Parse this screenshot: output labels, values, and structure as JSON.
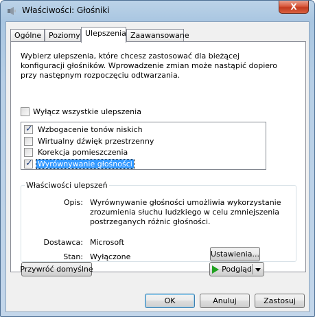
{
  "window": {
    "title": "Właściwości: Głośniki",
    "close_glyph": "X"
  },
  "tabs": [
    {
      "label": "Ogólne"
    },
    {
      "label": "Poziomy"
    },
    {
      "label": "Ulepszenia"
    },
    {
      "label": "Zaawansowane"
    }
  ],
  "enhancements": {
    "intro": "Wybierz ulepszenia, które chcesz zastosować dla bieżącej konfiguracji głośników. Wprowadzenie zmian może nastąpić dopiero przy następnym rozpoczęciu odtwarzania.",
    "disable_all": {
      "label": "Wyłącz wszystkie ulepszenia",
      "checked": false
    },
    "items": [
      {
        "label": "Wzbogacenie tonów niskich",
        "checked": true
      },
      {
        "label": "Wirtualny dźwięk przestrzenny",
        "checked": false
      },
      {
        "label": "Korekcja pomieszczenia",
        "checked": false
      },
      {
        "label": "Wyrównywanie głośności",
        "checked": true,
        "selected": true
      }
    ]
  },
  "properties": {
    "legend": "Właściwości ulepszeń",
    "opis_label": "Opis:",
    "opis_value": "Wyrównywanie głośności umożliwia wykorzystanie zrozumienia słuchu ludzkiego w celu zmniejszenia postrzeganych różnic głośności.",
    "vendor_label": "Dostawca:",
    "vendor_value": "Microsoft",
    "state_label": "Stan:",
    "state_value": "Wyłączone",
    "settings_button": "Ustawienia..."
  },
  "buttons": {
    "restore_defaults": "Przywróć domyślne",
    "preview": "Podgląd",
    "ok": "OK",
    "cancel": "Anuluj",
    "apply": "Zastosuj"
  }
}
